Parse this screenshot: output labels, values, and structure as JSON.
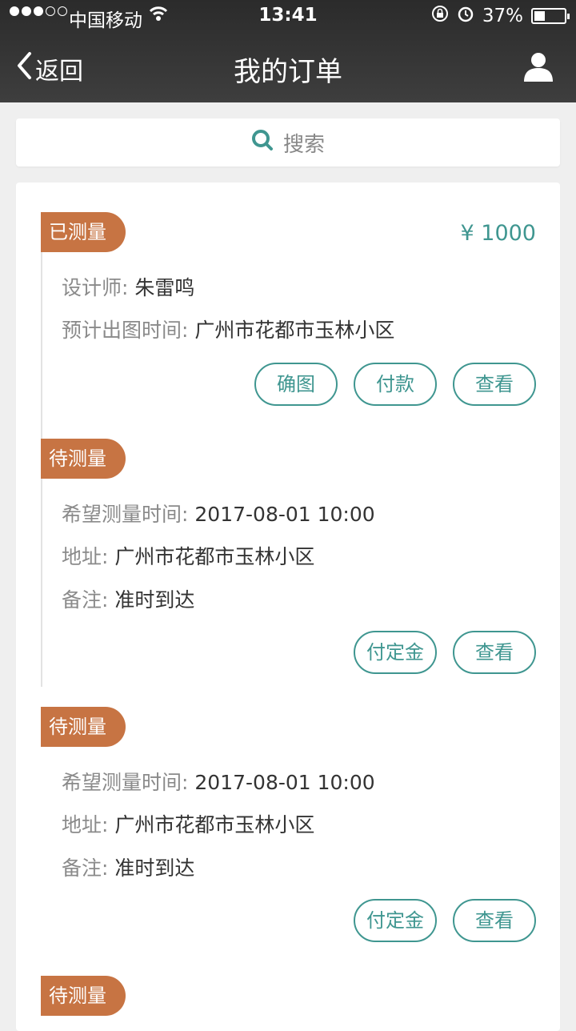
{
  "status_bar": {
    "carrier": "中国移动",
    "time": "13:41",
    "battery": "37%",
    "battery_level": 0.37
  },
  "nav": {
    "back_label": "返回",
    "title": "我的订单"
  },
  "search": {
    "placeholder": "搜索"
  },
  "orders": [
    {
      "status": "已测量",
      "price": "¥ 1000",
      "fields": [
        {
          "key": "设计师:",
          "value": "朱雷鸣"
        },
        {
          "key": "预计出图时间:",
          "value": "广州市花都市玉林小区"
        }
      ],
      "buttons": [
        "确图",
        "付款",
        "查看"
      ]
    },
    {
      "status": "待测量",
      "fields": [
        {
          "key": "希望测量时间:",
          "value": "2017-08-01 10:00"
        },
        {
          "key": "地址:",
          "value": "广州市花都市玉林小区"
        },
        {
          "key": "备注:",
          "value": "准时到达"
        }
      ],
      "buttons": [
        "付定金",
        "查看"
      ]
    },
    {
      "status": "待测量",
      "fields": [
        {
          "key": "希望测量时间:",
          "value": "2017-08-01 10:00"
        },
        {
          "key": "地址:",
          "value": "广州市花都市玉林小区"
        },
        {
          "key": "备注:",
          "value": "准时到达"
        }
      ],
      "buttons": [
        "付定金",
        "查看"
      ]
    },
    {
      "status": "待测量"
    }
  ],
  "colors": {
    "accent": "#3f9690",
    "badge": "#c77443",
    "header": "#333333"
  }
}
